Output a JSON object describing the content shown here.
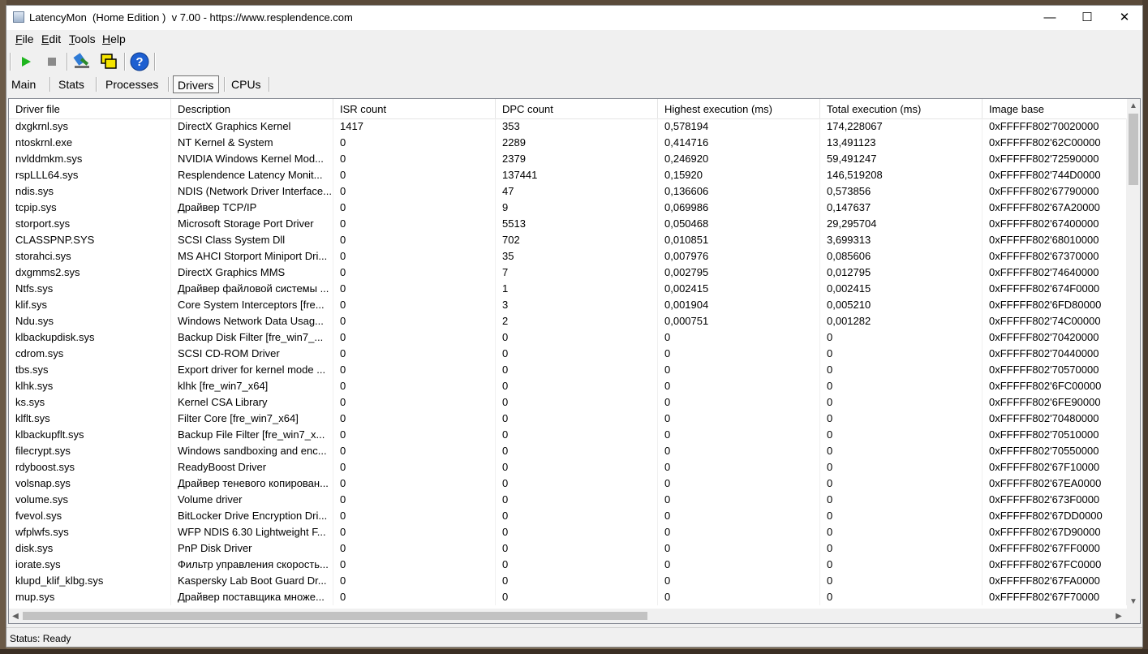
{
  "window": {
    "title": "LatencyMon  (Home Edition )  v 7.00 - https://www.resplendence.com",
    "minimize": "—",
    "maximize": "☐",
    "close": "✕"
  },
  "menu": {
    "file": {
      "u": "F",
      "rest": "ile"
    },
    "edit": {
      "u": "E",
      "rest": "dit"
    },
    "tools": {
      "u": "T",
      "rest": "ools"
    },
    "help": {
      "u": "H",
      "rest": "elp"
    }
  },
  "toolbar": {
    "start_icon": "play-icon",
    "stop_icon": "stop-icon",
    "tools_icon": "tools-icon",
    "windows_icon": "windows-icon",
    "help_icon": "help-icon",
    "help_glyph": "?"
  },
  "tabs": [
    {
      "label": "Main",
      "active": false
    },
    {
      "label": "Stats",
      "active": false
    },
    {
      "label": "Processes",
      "active": false
    },
    {
      "label": "Drivers",
      "active": true
    },
    {
      "label": "CPUs",
      "active": false
    }
  ],
  "table": {
    "columns": [
      "Driver file",
      "Description",
      "ISR count",
      "DPC count",
      "Highest execution (ms)",
      "Total execution (ms)",
      "Image base"
    ],
    "rows": [
      [
        "dxgkrnl.sys",
        "DirectX Graphics Kernel",
        "1417",
        "353",
        "0,578194",
        "174,228067",
        "0xFFFFF802'70020000"
      ],
      [
        "ntoskrnl.exe",
        "NT Kernel & System",
        "0",
        "2289",
        "0,414716",
        "13,491123",
        "0xFFFFF802'62C00000"
      ],
      [
        "nvlddmkm.sys",
        "NVIDIA Windows Kernel Mod...",
        "0",
        "2379",
        "0,246920",
        "59,491247",
        "0xFFFFF802'72590000"
      ],
      [
        "rspLLL64.sys",
        "Resplendence Latency Monit...",
        "0",
        "137441",
        "0,15920",
        "146,519208",
        "0xFFFFF802'744D0000"
      ],
      [
        "ndis.sys",
        "NDIS (Network Driver Interface...",
        "0",
        "47",
        "0,136606",
        "0,573856",
        "0xFFFFF802'67790000"
      ],
      [
        "tcpip.sys",
        "Драйвер TCP/IP",
        "0",
        "9",
        "0,069986",
        "0,147637",
        "0xFFFFF802'67A20000"
      ],
      [
        "storport.sys",
        "Microsoft Storage Port Driver",
        "0",
        "5513",
        "0,050468",
        "29,295704",
        "0xFFFFF802'67400000"
      ],
      [
        "CLASSPNP.SYS",
        "SCSI Class System Dll",
        "0",
        "702",
        "0,010851",
        "3,699313",
        "0xFFFFF802'68010000"
      ],
      [
        "storahci.sys",
        "MS AHCI Storport Miniport Dri...",
        "0",
        "35",
        "0,007976",
        "0,085606",
        "0xFFFFF802'67370000"
      ],
      [
        "dxgmms2.sys",
        "DirectX Graphics MMS",
        "0",
        "7",
        "0,002795",
        "0,012795",
        "0xFFFFF802'74640000"
      ],
      [
        "Ntfs.sys",
        "Драйвер файловой системы ...",
        "0",
        "1",
        "0,002415",
        "0,002415",
        "0xFFFFF802'674F0000"
      ],
      [
        "klif.sys",
        "Core System Interceptors [fre...",
        "0",
        "3",
        "0,001904",
        "0,005210",
        "0xFFFFF802'6FD80000"
      ],
      [
        "Ndu.sys",
        "Windows Network Data Usag...",
        "0",
        "2",
        "0,000751",
        "0,001282",
        "0xFFFFF802'74C00000"
      ],
      [
        "klbackupdisk.sys",
        "Backup Disk Filter [fre_win7_...",
        "0",
        "0",
        "0",
        "0",
        "0xFFFFF802'70420000"
      ],
      [
        "cdrom.sys",
        "SCSI CD-ROM Driver",
        "0",
        "0",
        "0",
        "0",
        "0xFFFFF802'70440000"
      ],
      [
        "tbs.sys",
        "Export driver for kernel mode ...",
        "0",
        "0",
        "0",
        "0",
        "0xFFFFF802'70570000"
      ],
      [
        "klhk.sys",
        "klhk [fre_win7_x64]",
        "0",
        "0",
        "0",
        "0",
        "0xFFFFF802'6FC00000"
      ],
      [
        "ks.sys",
        "Kernel CSA Library",
        "0",
        "0",
        "0",
        "0",
        "0xFFFFF802'6FE90000"
      ],
      [
        "klflt.sys",
        "Filter Core [fre_win7_x64]",
        "0",
        "0",
        "0",
        "0",
        "0xFFFFF802'70480000"
      ],
      [
        "klbackupflt.sys",
        "Backup File Filter [fre_win7_x...",
        "0",
        "0",
        "0",
        "0",
        "0xFFFFF802'70510000"
      ],
      [
        "filecrypt.sys",
        "Windows sandboxing and enc...",
        "0",
        "0",
        "0",
        "0",
        "0xFFFFF802'70550000"
      ],
      [
        "rdyboost.sys",
        "ReadyBoost Driver",
        "0",
        "0",
        "0",
        "0",
        "0xFFFFF802'67F10000"
      ],
      [
        "volsnap.sys",
        "Драйвер теневого копирован...",
        "0",
        "0",
        "0",
        "0",
        "0xFFFFF802'67EA0000"
      ],
      [
        "volume.sys",
        "Volume driver",
        "0",
        "0",
        "0",
        "0",
        "0xFFFFF802'673F0000"
      ],
      [
        "fvevol.sys",
        "BitLocker Drive Encryption Dri...",
        "0",
        "0",
        "0",
        "0",
        "0xFFFFF802'67DD0000"
      ],
      [
        "wfplwfs.sys",
        "WFP NDIS 6.30 Lightweight F...",
        "0",
        "0",
        "0",
        "0",
        "0xFFFFF802'67D90000"
      ],
      [
        "disk.sys",
        "PnP Disk Driver",
        "0",
        "0",
        "0",
        "0",
        "0xFFFFF802'67FF0000"
      ],
      [
        "iorate.sys",
        "Фильтр управления скорость...",
        "0",
        "0",
        "0",
        "0",
        "0xFFFFF802'67FC0000"
      ],
      [
        "klupd_klif_klbg.sys",
        "Kaspersky Lab Boot Guard Dr...",
        "0",
        "0",
        "0",
        "0",
        "0xFFFFF802'67FA0000"
      ],
      [
        "mup.sys",
        "Драйвер поставщика множе...",
        "0",
        "0",
        "0",
        "0",
        "0xFFFFF802'67F70000"
      ]
    ]
  },
  "status": {
    "text": "Status: Ready"
  },
  "colors": {
    "play_green": "#1fb51f",
    "stop_gray": "#8a8a8a",
    "help_blue": "#1d5fd1",
    "windows_yellow": "#f5e400"
  }
}
